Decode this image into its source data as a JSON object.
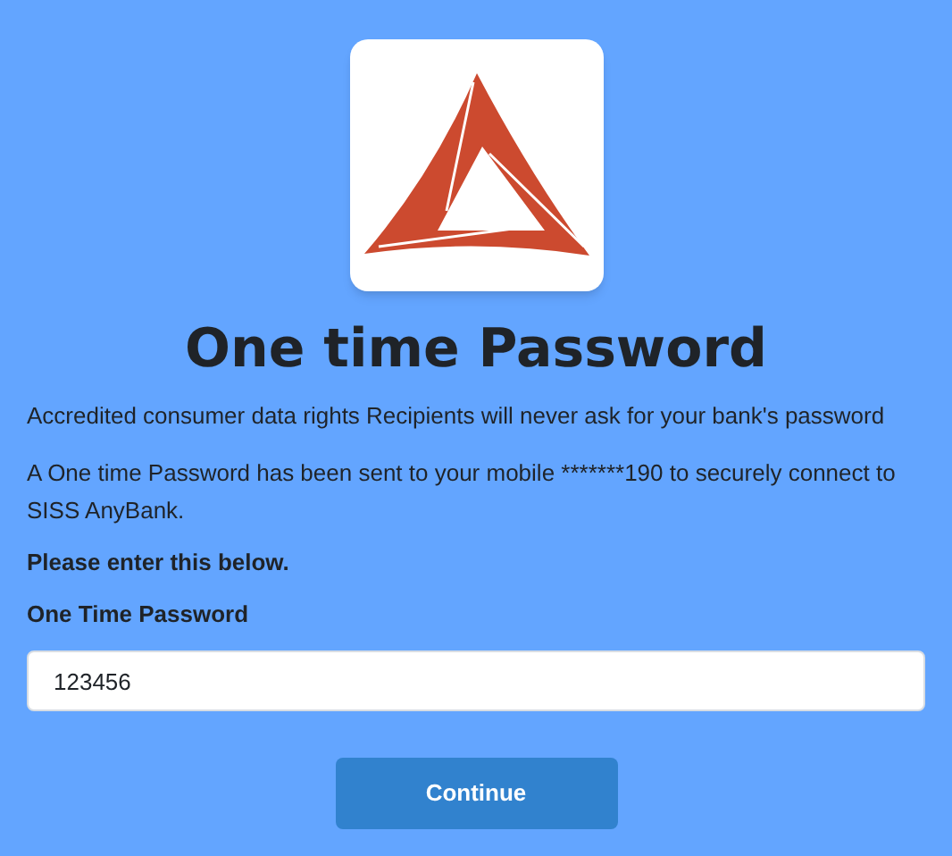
{
  "title": "One time Password",
  "notice": "Accredited consumer data rights Recipients will never ask for your bank's password",
  "message": "A One time Password has been sent to your mobile *******190 to securely connect to SISS AnyBank.",
  "instruction": "Please enter this below.",
  "field": {
    "label": "One Time Password",
    "value": "123456"
  },
  "button": "Continue"
}
